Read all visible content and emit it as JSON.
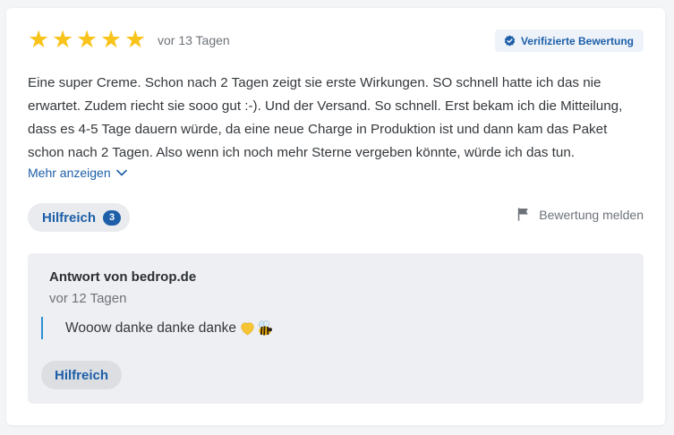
{
  "review": {
    "rating": 5,
    "rating_max": 5,
    "date": "vor 13 Tagen",
    "verified_label": "Verifizierte Bewertung",
    "text": "Eine super Creme. Schon nach 2 Tagen zeigt sie erste Wirkungen. SO schnell hatte ich das nie erwartet. Zudem riecht sie sooo gut :-). Und der Versand. So schnell. Erst bekam ich die Mitteilung, dass es 4-5 Tage dauern würde, da eine neue Charge in Produktion ist und dann kam das Paket schon nach 2 Tagen. Also wenn ich noch mehr Sterne vergeben könnte, würde ich das tun.",
    "show_more_label": "Mehr anzeigen",
    "helpful_label": "Hilfreich",
    "helpful_count": "3",
    "report_label": "Bewertung melden"
  },
  "reply": {
    "author": "Antwort von bedrop.de",
    "date": "vor 12 Tagen",
    "text": "Wooow danke danke danke",
    "emojis": [
      "yellow-heart",
      "honeybee"
    ],
    "helpful_label": "Hilfreich"
  },
  "colors": {
    "star": "#f8c41c",
    "accent": "#1d5fa8",
    "quote_bar": "#2b8fd4",
    "reply_bg": "#eeeff2"
  }
}
